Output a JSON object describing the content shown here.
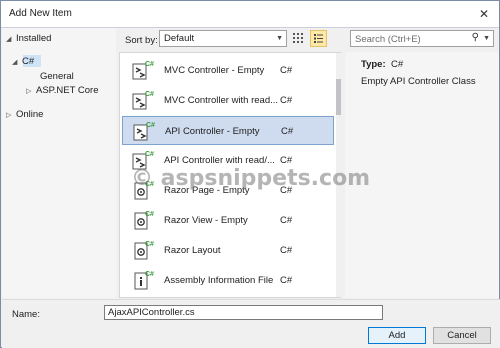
{
  "window": {
    "title": "Add New Item",
    "close_glyph": "✕"
  },
  "tree": {
    "installed": "Installed",
    "csharp": "C#",
    "general": "General",
    "aspnet": "ASP.NET Core",
    "online": "Online"
  },
  "toolbar": {
    "sort_label": "Sort by:",
    "sort_value": "Default"
  },
  "search": {
    "placeholder": "Search (Ctrl+E)"
  },
  "templates": [
    {
      "name": "MVC Controller - Empty",
      "lang": "C#",
      "icon": "controller-icon",
      "selected": false
    },
    {
      "name": "MVC Controller with read...",
      "lang": "C#",
      "icon": "controller-icon",
      "selected": false
    },
    {
      "name": "API Controller - Empty",
      "lang": "C#",
      "icon": "controller-icon",
      "selected": true
    },
    {
      "name": "API Controller with read/...",
      "lang": "C#",
      "icon": "controller-icon",
      "selected": false
    },
    {
      "name": "Razor Page - Empty",
      "lang": "C#",
      "icon": "razor-page-icon",
      "selected": false
    },
    {
      "name": "Razor View - Empty",
      "lang": "C#",
      "icon": "razor-view-icon",
      "selected": false
    },
    {
      "name": "Razor Layout",
      "lang": "C#",
      "icon": "razor-layout-icon",
      "selected": false
    },
    {
      "name": "Assembly Information File",
      "lang": "C#",
      "icon": "info-file-icon",
      "selected": false
    }
  ],
  "detail": {
    "type_label": "Type:",
    "type_value": "C#",
    "description": "Empty API Controller Class"
  },
  "watermark": "© aspsnippets.com",
  "footer": {
    "name_label": "Name:",
    "name_value": "AjaxAPIController.cs",
    "add_label": "Add",
    "cancel_label": "Cancel"
  },
  "colors": {
    "selection": "#cfdcf0",
    "accent": "#0078d7",
    "csharp_green": "#3a9a3a"
  }
}
